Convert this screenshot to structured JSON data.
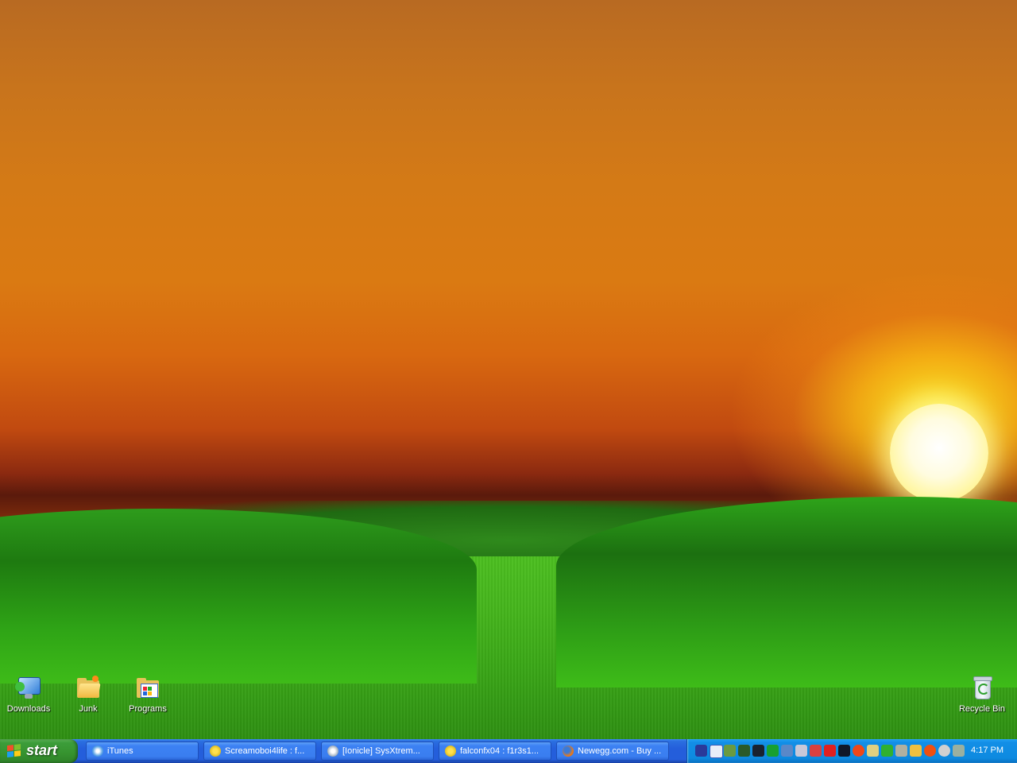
{
  "desktop": {
    "icons": [
      {
        "label": "Downloads",
        "icon": "monitor-download-icon"
      },
      {
        "label": "Junk",
        "icon": "folder-icon"
      },
      {
        "label": "Programs",
        "icon": "programs-folder-icon"
      },
      {
        "label": "Recycle Bin",
        "icon": "recycle-bin-icon"
      }
    ]
  },
  "taskbar": {
    "start_label": "start",
    "tasks": [
      {
        "label": "iTunes",
        "icon": "itunes-icon"
      },
      {
        "label": "Screamoboi4life : f...",
        "icon": "aim-chat-icon"
      },
      {
        "label": "[Ionicle] SysXtrem...",
        "icon": "chat-window-icon"
      },
      {
        "label": "falconfx04 : f1r3s1...",
        "icon": "aim-chat-icon"
      },
      {
        "label": "Newegg.com - Buy ...",
        "icon": "firefox-icon"
      }
    ],
    "tray_icons": [
      "antivirus-icon",
      "window-icon",
      "sound-icon",
      "runner-icon",
      "steam-icon",
      "green-x-icon",
      "network-icon",
      "usb-icon",
      "bluetooth-icon",
      "red-x-icon",
      "arrow-icon",
      "red-circle-icon",
      "battery-icon",
      "power-icon",
      "gear-icon",
      "display-icon",
      "orange-circle-icon",
      "disc-icon",
      "printer-icon"
    ],
    "clock": "4:17 PM"
  },
  "colors": {
    "taskbar_blue": "#245edb",
    "start_green": "#36932f",
    "tray_blue": "#0d8ae0"
  }
}
